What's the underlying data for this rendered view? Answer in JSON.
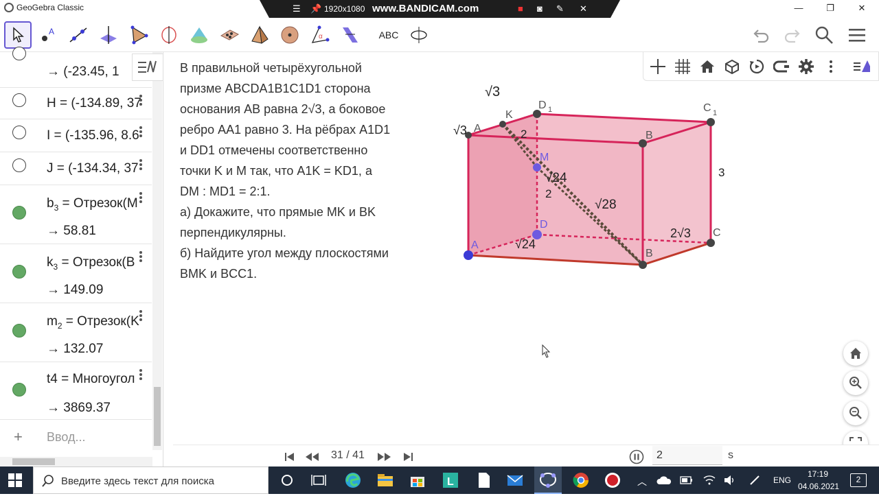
{
  "window": {
    "title": "GeoGebra Classic"
  },
  "recorder": {
    "resolution": "1920x1080",
    "brand": "www.BANDICAM.com"
  },
  "toolbar": {
    "text_tool_label": "ABC",
    "tools": [
      "move-tool",
      "point-tool",
      "line-tool",
      "perpendicular-tool",
      "polygon-tool",
      "circle-tool",
      "cone-tool",
      "plane-tool",
      "pyramid-tool",
      "sphere-tool",
      "angle-tool",
      "reflect-tool",
      "text-tool",
      "rotate-view-tool"
    ]
  },
  "algebra": {
    "rows": [
      {
        "value": "→  (-23.45,  1"
      },
      {
        "def": "H  =  (-134.89,  37"
      },
      {
        "def": "I  =  (-135.96,  8.6"
      },
      {
        "def": "J  =  (-134.34,  37"
      },
      {
        "def_name": "b",
        "def_sub": "3",
        "def_rest": "  =  Отрезок(M",
        "value": "→  58.81"
      },
      {
        "def_name": "k",
        "def_sub": "3",
        "def_rest": "  =  Отрезок(B",
        "value": "→  149.09"
      },
      {
        "def_name": "m",
        "def_sub": "2",
        "def_rest": "  =  Отрезок(K",
        "value": "→  132.07"
      },
      {
        "def": "t4  =  Многоугол",
        "value": "→  3869.37"
      }
    ],
    "input_placeholder": "Ввод...",
    "add_symbol": "+"
  },
  "problem_text": [
    "В правильной четырёхугольной",
    " призме ABCDA1B1C1D1 сторона",
    " основания AB равна 2√3, а боковое",
    " ребро AA1 равно 3. На рёбрах A1D1",
    " и DD1 отмечены соответственно",
    " точки K и M так, что A1K = KD1, а",
    " DM : MD1 = 2:1.",
    "а) Докажите, что прямые MK и BK",
    " перпендикулярны.",
    "б) Найдите угол между плоскостями",
    " BMK и BCC1."
  ],
  "figure_labels": {
    "A": "A",
    "B": "B",
    "C": "C",
    "D": "D",
    "A1": "A",
    "B1": "B",
    "C1": "C",
    "D1": "D",
    "sub1": "1",
    "K": "K",
    "M": "M",
    "sqrt3_top": "√3",
    "sqrt3_left": "√3",
    "two_a": "2",
    "two_b": "2",
    "three": "3",
    "sqrt24_a": "√24",
    "sqrt24_b": "√24",
    "sqrt28": "√28",
    "two_sqrt3": "2√3"
  },
  "colors": {
    "prism_fill": "#e0607e",
    "prism_edge": "#d6245a",
    "base_edge": "#c0392b",
    "segment": "#5a4a3a",
    "point": "#444444",
    "point_A": "#3b3bd6",
    "accent": "#6557d2",
    "marble_on": "#63a864"
  },
  "playback": {
    "counter": "31 / 41",
    "speed": "2",
    "unit": "s"
  },
  "taskbar": {
    "search_placeholder": "Введите здесь текст для поиска",
    "lang": "ENG",
    "time": "17:19",
    "date": "04.06.2021",
    "notifications": "2"
  }
}
